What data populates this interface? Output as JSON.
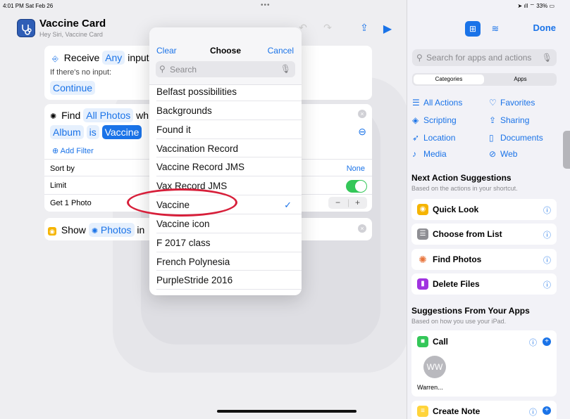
{
  "status": {
    "time": "4:01 PM",
    "date": "Sat Feb 26",
    "battery": "33%"
  },
  "header": {
    "title": "Vaccine Card",
    "subtitle": "Hey Siri, Vaccine Card"
  },
  "card1": {
    "action": "Receive",
    "any": "Any",
    "input_label": "input",
    "no_input": "If there's no input:",
    "continue": "Continue"
  },
  "card2": {
    "find": "Find",
    "all_photos": "All Photos",
    "where_frag": "wh",
    "album": "Album",
    "is": "is",
    "album_value": "Vaccine",
    "add_filter": "Add Filter",
    "sort_by": "Sort by",
    "sort_value": "None",
    "limit": "Limit",
    "get": "Get 1 Photo",
    "minus": "−",
    "plus": "+"
  },
  "card3": {
    "show": "Show",
    "photos": "Photos",
    "in_frag": "in"
  },
  "dropdown": {
    "clear": "Clear",
    "title": "Choose",
    "cancel": "Cancel",
    "search_placeholder": "Search",
    "items": [
      "Belfast possibilities",
      "Backgrounds",
      "Found it",
      "Vaccination Record",
      "Vaccine Record JMS",
      "Vax Record JMS",
      "Vaccine",
      "Vaccine icon",
      "F 2017 class",
      "French Polynesia",
      "PurpleStride 2016"
    ],
    "selected_index": 6
  },
  "right_panel": {
    "done": "Done",
    "search_placeholder": "Search for apps and actions",
    "segments": [
      "Categories",
      "Apps"
    ],
    "categories": [
      {
        "label": "All Actions",
        "icon": "list-icon"
      },
      {
        "label": "Favorites",
        "icon": "heart-icon"
      },
      {
        "label": "Scripting",
        "icon": "scripting-icon"
      },
      {
        "label": "Sharing",
        "icon": "share-icon"
      },
      {
        "label": "Location",
        "icon": "location-icon"
      },
      {
        "label": "Documents",
        "icon": "document-icon"
      },
      {
        "label": "Media",
        "icon": "music-note-icon"
      },
      {
        "label": "Web",
        "icon": "compass-icon"
      }
    ],
    "next_title": "Next Action Suggestions",
    "next_sub": "Based on the actions in your shortcut.",
    "suggestions": [
      {
        "label": "Quick Look",
        "color": "#f5b400"
      },
      {
        "label": "Choose from List",
        "color": "#8e8e93"
      },
      {
        "label": "Find Photos",
        "color": "#ffffff"
      },
      {
        "label": "Delete Files",
        "color": "#a033e0"
      }
    ],
    "apps_title": "Suggestions From Your Apps",
    "apps_sub": "Based on how you use your iPad.",
    "call": {
      "label": "Call",
      "initials": "WW",
      "caller": "Warren..."
    },
    "create_note": "Create Note"
  }
}
